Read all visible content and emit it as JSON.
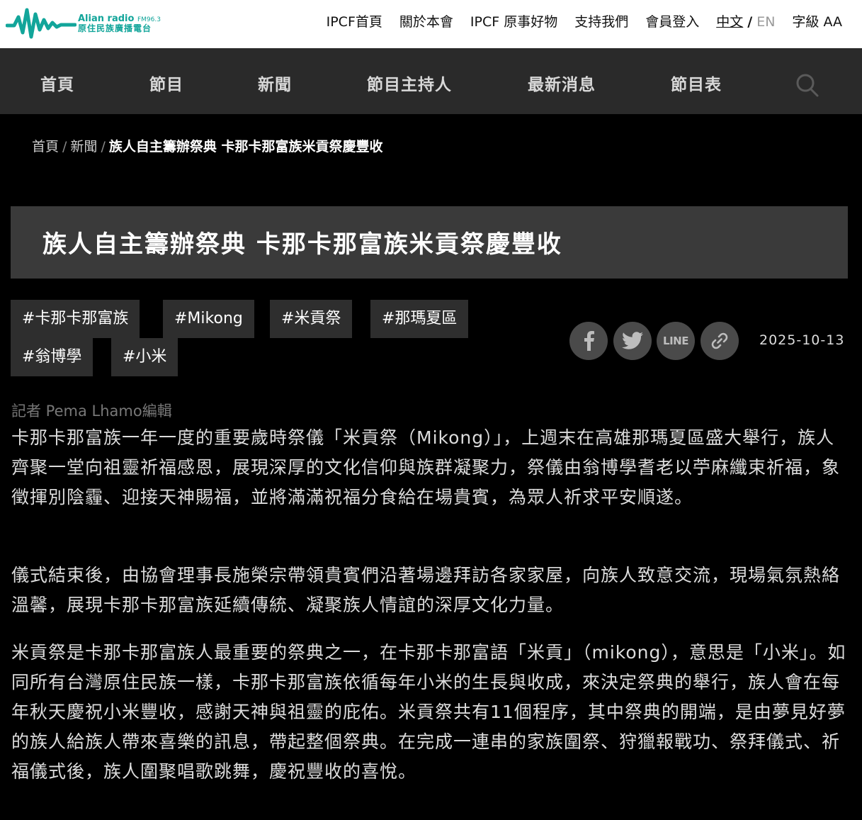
{
  "logo": {
    "line1": "Alian radio",
    "fm": "FM96.3",
    "line2": "原住民族廣播電台"
  },
  "topnav": {
    "items": [
      "IPCF首頁",
      "關於本會",
      "IPCF 原事好物",
      "支持我們",
      "會員登入"
    ],
    "lang_zh": "中文",
    "lang_sep": "/",
    "lang_en": "EN",
    "font_size": "字級 AA"
  },
  "mainnav": {
    "items": [
      "首頁",
      "節目",
      "新聞",
      "節目主持人",
      "最新消息",
      "節目表"
    ]
  },
  "breadcrumb": {
    "home": "首頁",
    "sep": "/",
    "section": "新聞",
    "current": "族人自主籌辦祭典 卡那卡那富族米貢祭慶豐收"
  },
  "article": {
    "title": "族人自主籌辦祭典 卡那卡那富族米貢祭慶豐收",
    "tags": [
      "#卡那卡那富族",
      "#Mikong",
      "#米貢祭",
      "#那瑪夏區",
      "#翁博學",
      "#小米"
    ],
    "share": {
      "line_label": "LINE"
    },
    "date": "2025-10-13",
    "byline": "記者 Pema Lhamo編輯",
    "paragraphs": [
      "卡那卡那富族一年一度的重要歲時祭儀「米貢祭（Mikong）」，上週末在高雄那瑪夏區盛大舉行，族人齊聚一堂向祖靈祈福感恩，展現深厚的文化信仰與族群凝聚力，祭儀由翁博學耆老以苧麻纖束祈福，象徵揮別陰霾、迎接天神賜福，並將滿滿祝福分食給在場貴賓，為眾人祈求平安順遂。",
      "儀式結束後，由協會理事長施榮宗帶領貴賓們沿著場邊拜訪各家家屋，向族人致意交流，現場氣氛熱絡溫馨，展現卡那卡那富族延續傳統、凝聚族人情誼的深厚文化力量。",
      "米貢祭是卡那卡那富族人最重要的祭典之一，在卡那卡那富語「米貢」（mikong），意思是「小米」。如同所有台灣原住民族一樣，卡那卡那富族依循每年小米的生長與收成，來決定祭典的舉行，族人會在每年秋天慶祝小米豐收，感謝天神與祖靈的庇佑。米貢祭共有11個程序，其中祭典的開端，是由夢見好夢的族人給族人帶來喜樂的訊息，帶起整個祭典。在完成一連串的家族圍祭、狩獵報戰功、祭拜儀式、祈福儀式後，族人圍聚唱歌跳舞，慶祝豐收的喜悅。"
    ]
  },
  "colors": {
    "brand": "#12a59a",
    "nav_bg": "#2a2a2a",
    "title_bg": "#3a3a3a",
    "tag_bg": "#2e2e2e",
    "share_bg": "#4a4a4a"
  }
}
